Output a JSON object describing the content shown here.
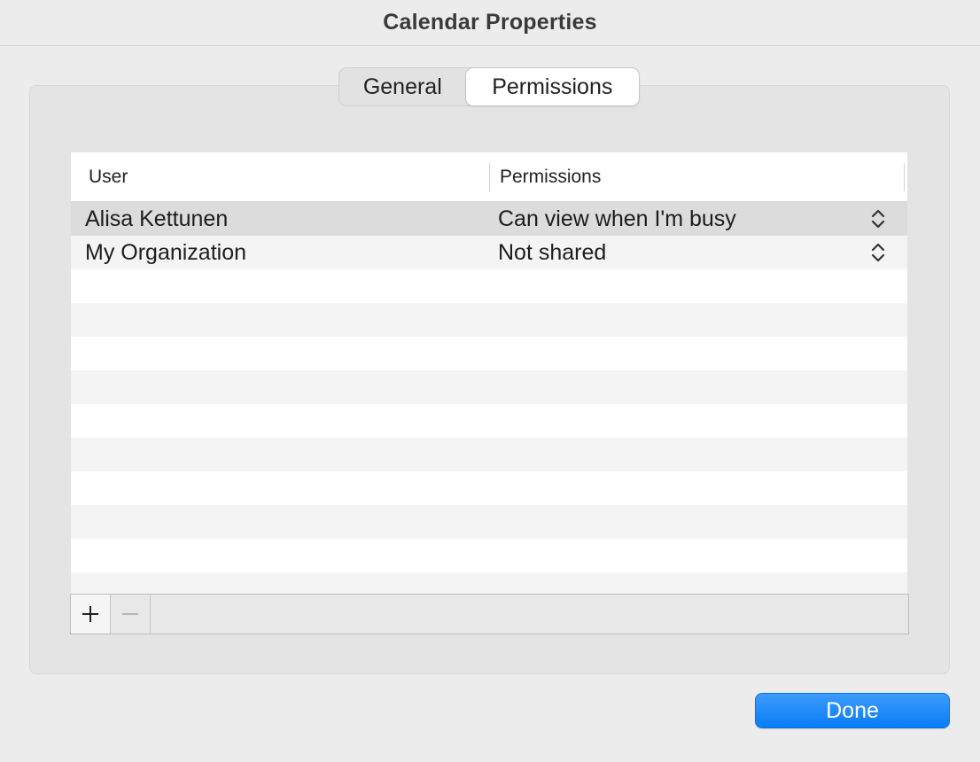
{
  "window": {
    "title": "Calendar Properties"
  },
  "tabs": [
    {
      "label": "General",
      "selected": false
    },
    {
      "label": "Permissions",
      "selected": true
    }
  ],
  "table": {
    "columns": [
      "User",
      "Permissions"
    ],
    "rows": [
      {
        "user": "Alisa Kettunen",
        "permission": "Can view when I'm busy",
        "selected": true
      },
      {
        "user": "My Organization",
        "permission": "Not shared",
        "selected": false
      }
    ]
  },
  "toolbar": {
    "add_icon": "plus-icon",
    "remove_icon": "minus-icon"
  },
  "footer": {
    "done_label": "Done"
  },
  "colors": {
    "accent": "#0a7cf5",
    "selected_row": "#dcdcdc",
    "stripe": "#f3f4f3"
  }
}
